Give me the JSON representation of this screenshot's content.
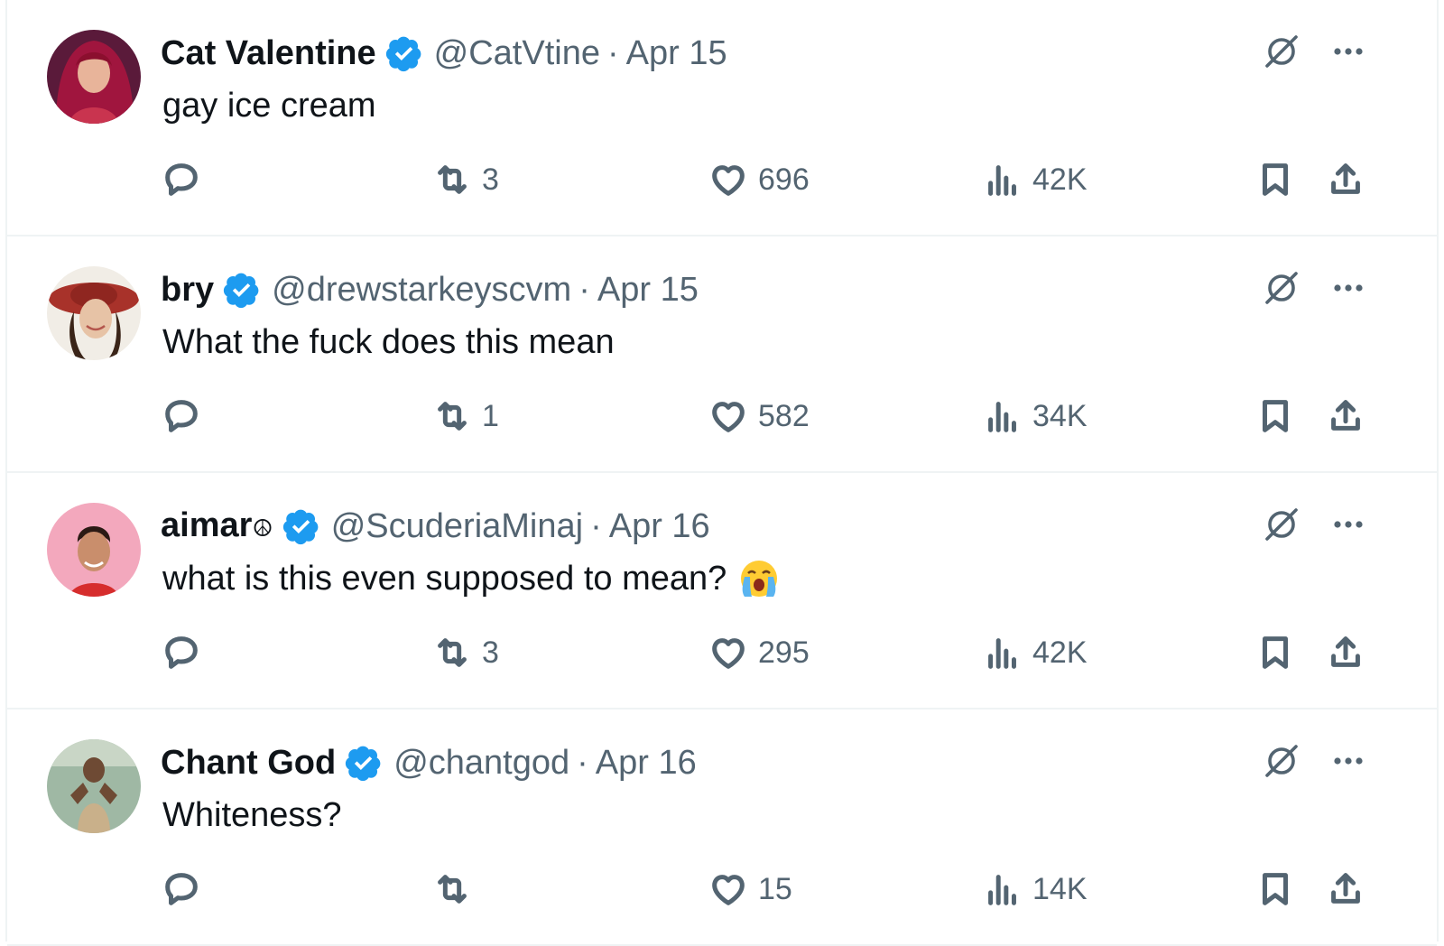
{
  "colors": {
    "verified_badge": "#1d9bf0",
    "text_primary": "#0f1419",
    "text_secondary": "#536471",
    "divider": "#eff3f4"
  },
  "icons": {
    "verified": "verified-badge-icon",
    "grok": "grok-icon",
    "more": "more-icon",
    "reply": "reply-icon",
    "retweet": "retweet-icon",
    "like": "heart-icon",
    "views": "views-icon",
    "bookmark": "bookmark-icon",
    "share": "share-icon"
  },
  "tweets": [
    {
      "name": "Cat Valentine",
      "handle": "@CatVtine",
      "separator": "·",
      "date": "Apr 15",
      "text": "gay ice cream",
      "retweets": "3",
      "likes": "696",
      "views": "42K"
    },
    {
      "name": "bry",
      "handle": "@drewstarkeyscvm",
      "separator": "·",
      "date": "Apr 15",
      "text": "What the fuck does this mean",
      "retweets": "1",
      "likes": "582",
      "views": "34K"
    },
    {
      "name": "aimar",
      "name_symbol": "☮",
      "handle": "@ScuderiaMinaj",
      "separator": "·",
      "date": "Apr 16",
      "text": "what is this even supposed to mean?",
      "emoji": "loudly-crying-face-emoji",
      "retweets": "3",
      "likes": "295",
      "views": "42K"
    },
    {
      "name": "Chant God",
      "handle": "@chantgod",
      "separator": "·",
      "date": "Apr 16",
      "text": "Whiteness?",
      "retweets": "",
      "likes": "15",
      "views": "14K"
    }
  ]
}
